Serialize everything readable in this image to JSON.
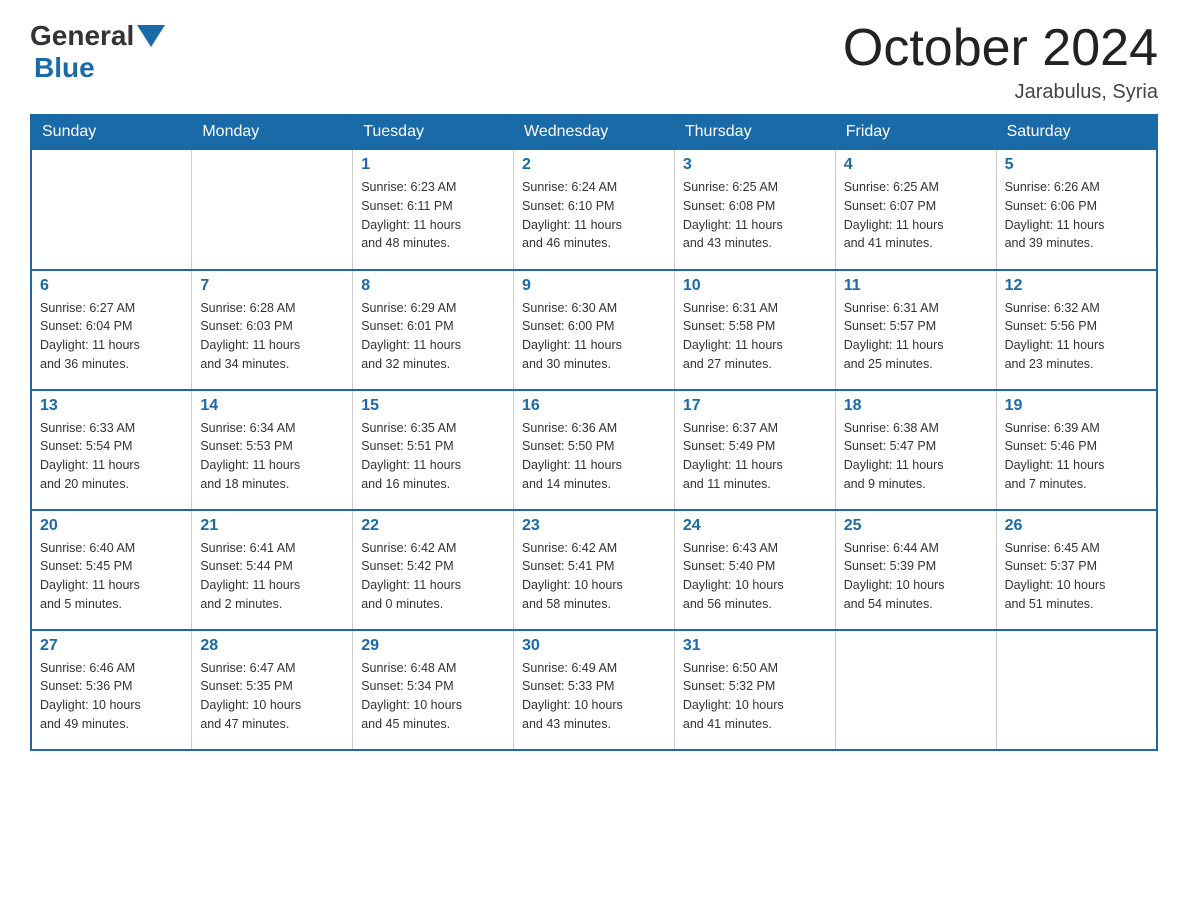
{
  "header": {
    "title": "October 2024",
    "location": "Jarabulus, Syria",
    "logo_general": "General",
    "logo_blue": "Blue"
  },
  "days_of_week": [
    "Sunday",
    "Monday",
    "Tuesday",
    "Wednesday",
    "Thursday",
    "Friday",
    "Saturday"
  ],
  "weeks": [
    [
      {
        "day": "",
        "info": ""
      },
      {
        "day": "",
        "info": ""
      },
      {
        "day": "1",
        "info": "Sunrise: 6:23 AM\nSunset: 6:11 PM\nDaylight: 11 hours\nand 48 minutes."
      },
      {
        "day": "2",
        "info": "Sunrise: 6:24 AM\nSunset: 6:10 PM\nDaylight: 11 hours\nand 46 minutes."
      },
      {
        "day": "3",
        "info": "Sunrise: 6:25 AM\nSunset: 6:08 PM\nDaylight: 11 hours\nand 43 minutes."
      },
      {
        "day": "4",
        "info": "Sunrise: 6:25 AM\nSunset: 6:07 PM\nDaylight: 11 hours\nand 41 minutes."
      },
      {
        "day": "5",
        "info": "Sunrise: 6:26 AM\nSunset: 6:06 PM\nDaylight: 11 hours\nand 39 minutes."
      }
    ],
    [
      {
        "day": "6",
        "info": "Sunrise: 6:27 AM\nSunset: 6:04 PM\nDaylight: 11 hours\nand 36 minutes."
      },
      {
        "day": "7",
        "info": "Sunrise: 6:28 AM\nSunset: 6:03 PM\nDaylight: 11 hours\nand 34 minutes."
      },
      {
        "day": "8",
        "info": "Sunrise: 6:29 AM\nSunset: 6:01 PM\nDaylight: 11 hours\nand 32 minutes."
      },
      {
        "day": "9",
        "info": "Sunrise: 6:30 AM\nSunset: 6:00 PM\nDaylight: 11 hours\nand 30 minutes."
      },
      {
        "day": "10",
        "info": "Sunrise: 6:31 AM\nSunset: 5:58 PM\nDaylight: 11 hours\nand 27 minutes."
      },
      {
        "day": "11",
        "info": "Sunrise: 6:31 AM\nSunset: 5:57 PM\nDaylight: 11 hours\nand 25 minutes."
      },
      {
        "day": "12",
        "info": "Sunrise: 6:32 AM\nSunset: 5:56 PM\nDaylight: 11 hours\nand 23 minutes."
      }
    ],
    [
      {
        "day": "13",
        "info": "Sunrise: 6:33 AM\nSunset: 5:54 PM\nDaylight: 11 hours\nand 20 minutes."
      },
      {
        "day": "14",
        "info": "Sunrise: 6:34 AM\nSunset: 5:53 PM\nDaylight: 11 hours\nand 18 minutes."
      },
      {
        "day": "15",
        "info": "Sunrise: 6:35 AM\nSunset: 5:51 PM\nDaylight: 11 hours\nand 16 minutes."
      },
      {
        "day": "16",
        "info": "Sunrise: 6:36 AM\nSunset: 5:50 PM\nDaylight: 11 hours\nand 14 minutes."
      },
      {
        "day": "17",
        "info": "Sunrise: 6:37 AM\nSunset: 5:49 PM\nDaylight: 11 hours\nand 11 minutes."
      },
      {
        "day": "18",
        "info": "Sunrise: 6:38 AM\nSunset: 5:47 PM\nDaylight: 11 hours\nand 9 minutes."
      },
      {
        "day": "19",
        "info": "Sunrise: 6:39 AM\nSunset: 5:46 PM\nDaylight: 11 hours\nand 7 minutes."
      }
    ],
    [
      {
        "day": "20",
        "info": "Sunrise: 6:40 AM\nSunset: 5:45 PM\nDaylight: 11 hours\nand 5 minutes."
      },
      {
        "day": "21",
        "info": "Sunrise: 6:41 AM\nSunset: 5:44 PM\nDaylight: 11 hours\nand 2 minutes."
      },
      {
        "day": "22",
        "info": "Sunrise: 6:42 AM\nSunset: 5:42 PM\nDaylight: 11 hours\nand 0 minutes."
      },
      {
        "day": "23",
        "info": "Sunrise: 6:42 AM\nSunset: 5:41 PM\nDaylight: 10 hours\nand 58 minutes."
      },
      {
        "day": "24",
        "info": "Sunrise: 6:43 AM\nSunset: 5:40 PM\nDaylight: 10 hours\nand 56 minutes."
      },
      {
        "day": "25",
        "info": "Sunrise: 6:44 AM\nSunset: 5:39 PM\nDaylight: 10 hours\nand 54 minutes."
      },
      {
        "day": "26",
        "info": "Sunrise: 6:45 AM\nSunset: 5:37 PM\nDaylight: 10 hours\nand 51 minutes."
      }
    ],
    [
      {
        "day": "27",
        "info": "Sunrise: 6:46 AM\nSunset: 5:36 PM\nDaylight: 10 hours\nand 49 minutes."
      },
      {
        "day": "28",
        "info": "Sunrise: 6:47 AM\nSunset: 5:35 PM\nDaylight: 10 hours\nand 47 minutes."
      },
      {
        "day": "29",
        "info": "Sunrise: 6:48 AM\nSunset: 5:34 PM\nDaylight: 10 hours\nand 45 minutes."
      },
      {
        "day": "30",
        "info": "Sunrise: 6:49 AM\nSunset: 5:33 PM\nDaylight: 10 hours\nand 43 minutes."
      },
      {
        "day": "31",
        "info": "Sunrise: 6:50 AM\nSunset: 5:32 PM\nDaylight: 10 hours\nand 41 minutes."
      },
      {
        "day": "",
        "info": ""
      },
      {
        "day": "",
        "info": ""
      }
    ]
  ]
}
